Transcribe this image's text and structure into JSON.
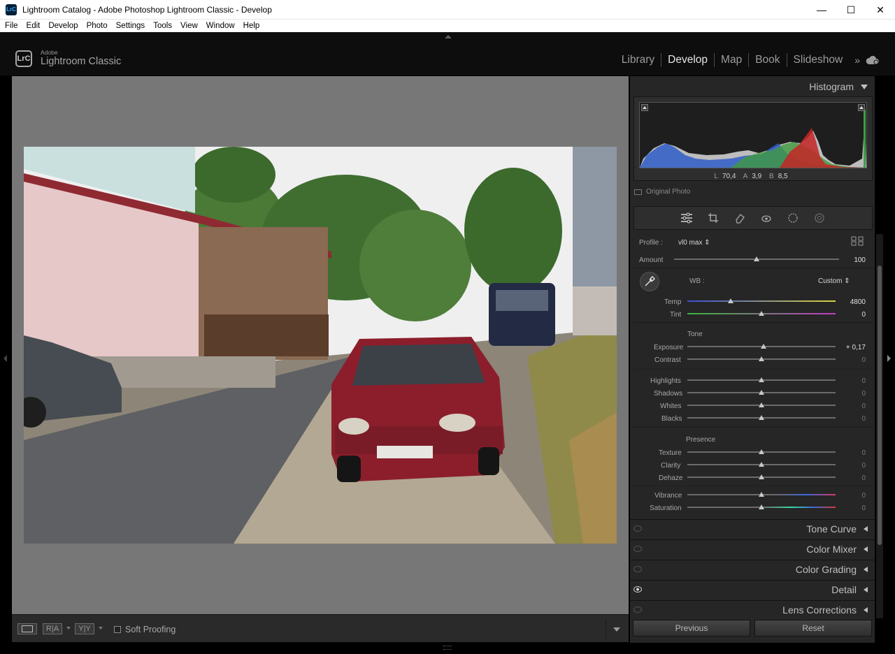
{
  "window": {
    "title": "Lightroom Catalog - Adobe Photoshop Lightroom Classic - Develop",
    "app_icon": "LrC",
    "minimize": "—",
    "maximize": "☐",
    "close": "✕"
  },
  "menu": [
    "File",
    "Edit",
    "Develop",
    "Photo",
    "Settings",
    "Tools",
    "View",
    "Window",
    "Help"
  ],
  "brand": {
    "badge": "LrC",
    "small": "Adobe",
    "big": "Lightroom Classic"
  },
  "modules": [
    "Library",
    "Develop",
    "Map",
    "Book",
    "Slideshow"
  ],
  "modules_more": "»",
  "toolbar": {
    "compare_ra": "R|A",
    "compare_yy": "Y|Y",
    "soft_proofing": "Soft Proofing"
  },
  "histogram": {
    "title": "Histogram",
    "L_label": "L",
    "L": "70,4",
    "A_label": "A",
    "A": "3,9",
    "B_label": "B",
    "B": "8,5",
    "original_photo": "Original Photo"
  },
  "basic": {
    "profile_label": "Profile :",
    "profile_value": "vl0 max ⇕",
    "amount_label": "Amount",
    "amount_value": "100",
    "amount_pos": 1.0,
    "wb_label": "WB :",
    "wb_value": "Custom ⇕",
    "temp_label": "Temp",
    "temp_value": "4800",
    "tint_label": "Tint",
    "tint_value": "0",
    "tone_title": "Tone",
    "exposure_label": "Exposure",
    "exposure_value": "+ 0,17",
    "contrast_label": "Contrast",
    "contrast_value": "0",
    "highlights_label": "Highlights",
    "highlights_value": "0",
    "shadows_label": "Shadows",
    "shadows_value": "0",
    "whites_label": "Whites",
    "whites_value": "0",
    "blacks_label": "Blacks",
    "blacks_value": "0",
    "presence_title": "Presence",
    "texture_label": "Texture",
    "texture_value": "0",
    "clarity_label": "Clarity",
    "clarity_value": "0",
    "dehaze_label": "Dehaze",
    "dehaze_value": "0",
    "vibrance_label": "Vibrance",
    "vibrance_value": "0",
    "saturation_label": "Saturation",
    "saturation_value": "0"
  },
  "panels": [
    "Tone Curve",
    "Color Mixer",
    "Color Grading",
    "Detail",
    "Lens Corrections"
  ],
  "buttons": {
    "previous": "Previous",
    "reset": "Reset"
  }
}
